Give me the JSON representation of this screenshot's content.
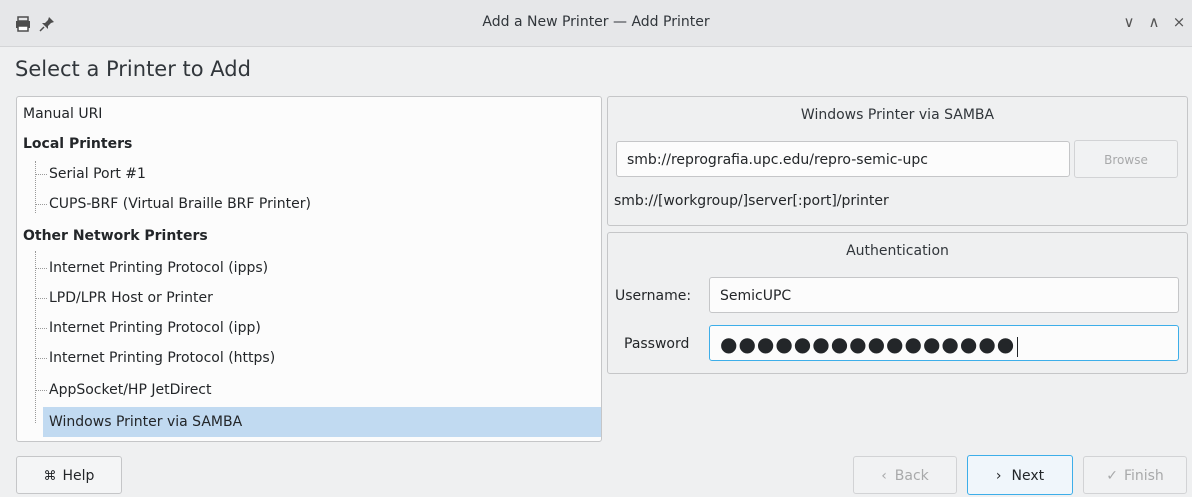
{
  "window": {
    "title": "Add a New Printer — Add Printer",
    "icons": [
      "printer-icon",
      "pin-icon"
    ],
    "controls": {
      "minimize": "∨",
      "maximize": "∧",
      "close": "×"
    }
  },
  "page": {
    "heading": "Select a Printer to Add"
  },
  "tree": {
    "items": [
      {
        "label": "Manual URI",
        "kind": "top"
      },
      {
        "label": "Local Printers",
        "kind": "group"
      },
      {
        "label": "Serial Port #1",
        "kind": "child"
      },
      {
        "label": "CUPS-BRF (Virtual Braille BRF Printer)",
        "kind": "child"
      },
      {
        "label": "Other Network Printers",
        "kind": "group"
      },
      {
        "label": "Internet Printing Protocol (ipps)",
        "kind": "child"
      },
      {
        "label": "LPD/LPR Host or Printer",
        "kind": "child"
      },
      {
        "label": "Internet Printing Protocol (ipp)",
        "kind": "child"
      },
      {
        "label": "Internet Printing Protocol (https)",
        "kind": "child"
      },
      {
        "label": "AppSocket/HP JetDirect",
        "kind": "child"
      },
      {
        "label": "Windows Printer via SAMBA",
        "kind": "child",
        "selected": true
      }
    ]
  },
  "samba": {
    "title": "Windows Printer via SAMBA",
    "uri_value": "smb://reprografia.upc.edu/repro-semic-upc",
    "browse_label": "Browse",
    "hint": "smb://[workgroup/]server[:port]/printer"
  },
  "auth": {
    "title": "Authentication",
    "username_label": "Username:",
    "username_value": "SemicUPC",
    "password_label": "Password",
    "password_mask": "●●●●●●●●●●●●●●●●"
  },
  "buttons": {
    "help": "Help",
    "back": "Back",
    "next": "Next",
    "finish": "Finish"
  },
  "colors": {
    "accent": "#3daee9",
    "selection": "#c1daf1"
  }
}
